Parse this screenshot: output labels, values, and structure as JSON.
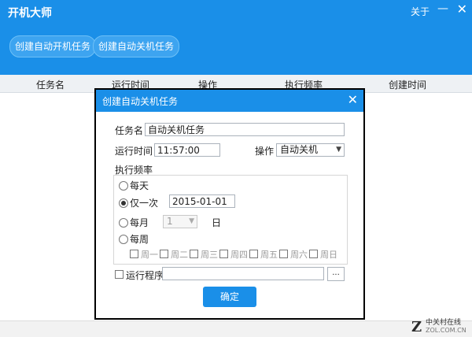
{
  "app": {
    "title": "开机大师",
    "about": "关于",
    "minimize": "—",
    "close": "✕"
  },
  "toolbar": {
    "create_boot_task": "创建自动开机任务",
    "create_shutdown_task": "创建自动关机任务"
  },
  "table": {
    "columns": [
      "任务名",
      "运行时间",
      "操作",
      "执行频率",
      "创建时间"
    ]
  },
  "dialog": {
    "title": "创建自动关机任务",
    "close": "✕",
    "task_name_label": "任务名",
    "task_name_value": "自动关机任务",
    "run_time_label": "运行时间",
    "run_time_value": "11:57:00",
    "action_label": "操作",
    "action_value": "自动关机",
    "frequency_label": "执行频率",
    "freq_daily": "每天",
    "freq_once": "仅一次",
    "once_date": "2015-01-01",
    "freq_monthly": "每月",
    "monthly_day": "1",
    "day_unit": "日",
    "freq_weekly": "每周",
    "weekdays": [
      "周一",
      "周二",
      "周三",
      "周四",
      "周五",
      "周六",
      "周日"
    ],
    "run_program_label": "运行程序",
    "browse": "...",
    "ok": "确定"
  },
  "watermark": {
    "logo": "Z",
    "text": "中关村在线",
    "sub": "ZOL.COM.CN"
  },
  "colors": {
    "primary": "#1a8fe8"
  }
}
